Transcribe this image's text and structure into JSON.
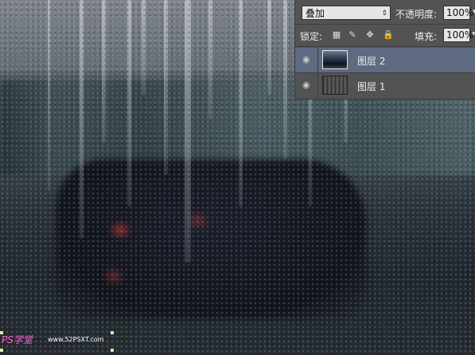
{
  "layers_panel": {
    "blend_mode": "叠加",
    "opacity_label": "不透明度:",
    "opacity_value": "100%",
    "lock_label": "锁定:",
    "fill_label": "填充:",
    "fill_value": "100%",
    "layers": [
      {
        "name": "图层 2",
        "selected": true,
        "thumbnail": "rain-photo-thumbnail"
      },
      {
        "name": "图层 1",
        "selected": false,
        "thumbnail": "texture-thumbnail"
      }
    ],
    "lock_icons": [
      "lock-transparent-pixels-icon",
      "lock-image-pixels-icon",
      "lock-position-icon",
      "lock-all-icon"
    ],
    "colors": {
      "panel_bg": "#535353",
      "selected_row": "#5d6a82"
    }
  },
  "watermark": {
    "logo_text": "PS学堂",
    "site_text": "www.52PSXT.com"
  }
}
